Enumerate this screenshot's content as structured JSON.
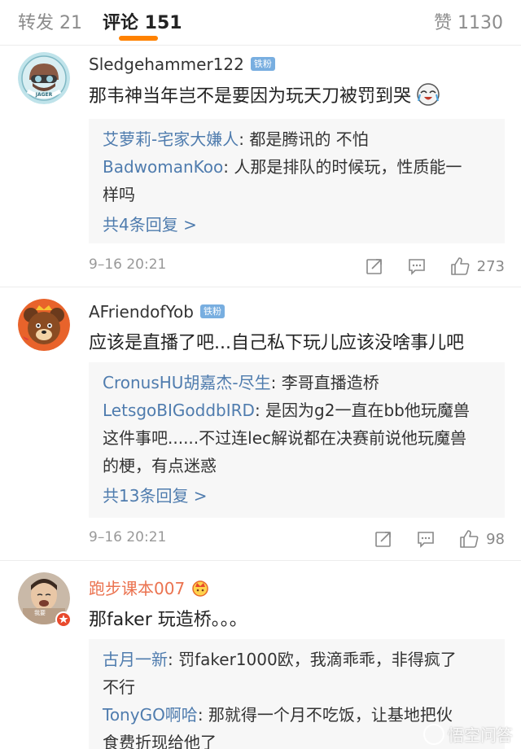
{
  "tabs": {
    "repost": "转发 21",
    "comment": "评论 151",
    "like": "赞 1130"
  },
  "badge": "铁粉",
  "comments": [
    {
      "user": "Sledgehammer122",
      "text": "那韦神当年岂不是要因为玩天刀被罚到哭",
      "replies": [
        {
          "name": "艾萝莉-宅家大嫌人",
          "text": "都是腾讯的 不怕"
        },
        {
          "name": "BadwomanKoo",
          "text": "人那是排队的时候玩，性质能一",
          "text2": "样吗"
        }
      ],
      "more": "共4条回复 >",
      "time": "9–16 20:21",
      "likes": "273"
    },
    {
      "user": "AFriendofYob",
      "text": "应该是直播了吧...自己私下玩儿应该没啥事儿吧",
      "replies": [
        {
          "name": "CronusHU胡嘉杰-尽生",
          "text": "李哥直播造桥"
        },
        {
          "name": "LetsgoBIGoddbIRD",
          "text": "是因为g2一直在bb他玩魔兽",
          "text2": "这件事吧......不过连lec解说都在决赛前说他玩魔兽",
          "text3": "的梗，有点迷惑"
        }
      ],
      "more": "共13条回复 >",
      "time": "9–16 20:21",
      "likes": "98"
    },
    {
      "user": "跑步课本007",
      "text": "那faker 玩造桥。。。",
      "replies": [
        {
          "name": "古月一新",
          "text": "罚faker1000欧，我滴乖乖，非得疯了",
          "text2": "不行"
        },
        {
          "name": "TonyGO啊哈",
          "text": "那就得一个月不吃饭，让基地把伙",
          "text2": "食费折现给他了"
        }
      ]
    }
  ],
  "watermark": "悟空问答",
  "colors": {
    "accent": "#ff8200",
    "link": "#4f7cae",
    "vip_name": "#eb7350",
    "badge": "#78aee0"
  }
}
